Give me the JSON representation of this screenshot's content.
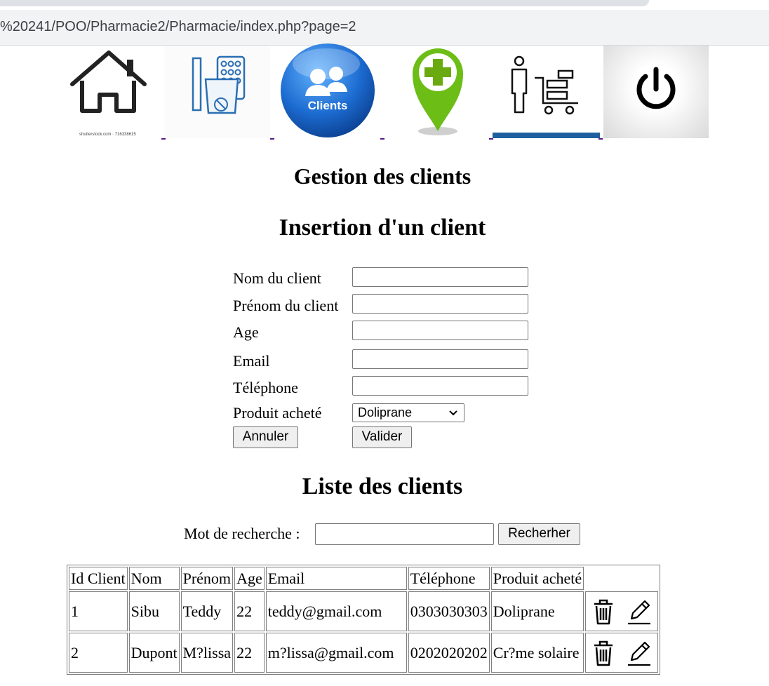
{
  "browser": {
    "url": "%20241/POO/Pharmacie2/Pharmacie/index.php?page=2"
  },
  "nav": {
    "tiles": [
      {
        "name": "home",
        "icon": "home-icon",
        "caption": "shutterstock.com · 716338615"
      },
      {
        "name": "medicaments",
        "icon": "medicine-icon"
      },
      {
        "name": "clients",
        "icon": "clients-icon",
        "text": "Clients"
      },
      {
        "name": "pharmacie",
        "icon": "pharmacy-pin-icon"
      },
      {
        "name": "commandes",
        "icon": "person-cart-icon"
      },
      {
        "name": "logout",
        "icon": "power-icon"
      }
    ]
  },
  "page": {
    "title": "Gestion des clients",
    "insert_title": "Insertion d'un client",
    "list_title": "Liste des clients"
  },
  "form": {
    "nom_label": "Nom du client",
    "prenom_label": "Prénom du client",
    "age_label": "Age",
    "email_label": "Email",
    "telephone_label": "Téléphone",
    "produit_label": "Produit acheté",
    "produit_selected": "Doliprane",
    "cancel_label": "Annuler",
    "submit_label": "Valider"
  },
  "search": {
    "label": "Mot de recherche :",
    "button_label": "Recherher"
  },
  "table": {
    "headers": [
      "Id Client",
      "Nom",
      "Prénom",
      "Age",
      "Email",
      "Téléphone",
      "Produit acheté",
      ""
    ],
    "rows": [
      {
        "id": "1",
        "nom": "Sibu",
        "prenom": "Teddy",
        "age": "22",
        "email": "teddy@gmail.com",
        "telephone": "0303030303",
        "produit": "Doliprane"
      },
      {
        "id": "2",
        "nom": "Dupont",
        "prenom": "M?lissa",
        "age": "22",
        "email": "m?lissa@gmail.com",
        "telephone": "0202020202",
        "produit": "Cr?me solaire"
      }
    ]
  },
  "colors": {
    "link_dash": "#551a8b",
    "clients_blue": "#1f6fc9",
    "pin_green": "#6cbd16",
    "cross_green": "#6aa90f"
  }
}
